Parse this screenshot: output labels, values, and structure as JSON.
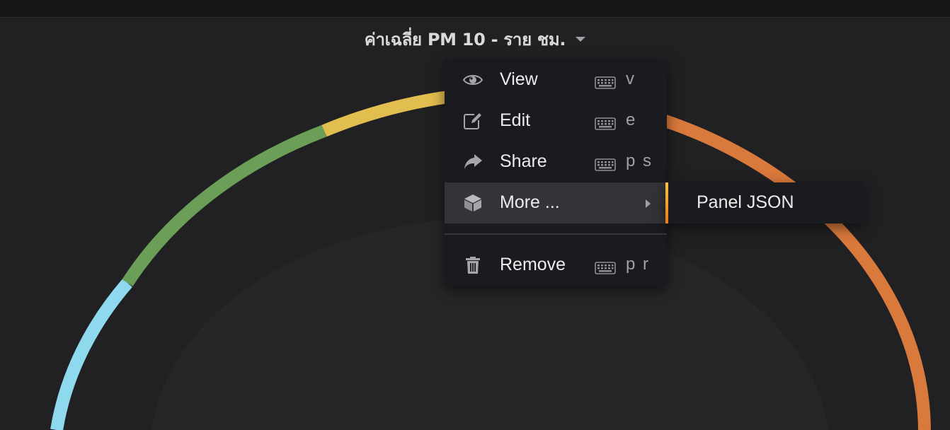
{
  "panel": {
    "title": "ค่าเฉลี่ย PM 10 - ราย ชม.",
    "title_menu_icon": "caret-down-icon"
  },
  "gauge": {
    "colors": {
      "background_track": "#262628",
      "segment_blue": "#8fd9ee",
      "segment_green": "#6b9e56",
      "segment_yellow": "#e2bd4f",
      "segment_orange": "#d9793b"
    }
  },
  "context_menu": {
    "items": [
      {
        "label": "View",
        "icon": "eye-icon",
        "shortcut": "v"
      },
      {
        "label": "Edit",
        "icon": "edit-icon",
        "shortcut": "e"
      },
      {
        "label": "Share",
        "icon": "share-icon",
        "shortcut": "p s"
      },
      {
        "label": "More ...",
        "icon": "cube-icon",
        "has_submenu": true,
        "active": true
      },
      {
        "label": "Remove",
        "icon": "trash-icon",
        "shortcut": "p r"
      }
    ],
    "shortcut_icon": "keyboard-icon"
  },
  "submenu": {
    "items": [
      {
        "label": "Panel JSON"
      }
    ],
    "accent_colors": [
      "#f6c344",
      "#eb7b18"
    ]
  }
}
